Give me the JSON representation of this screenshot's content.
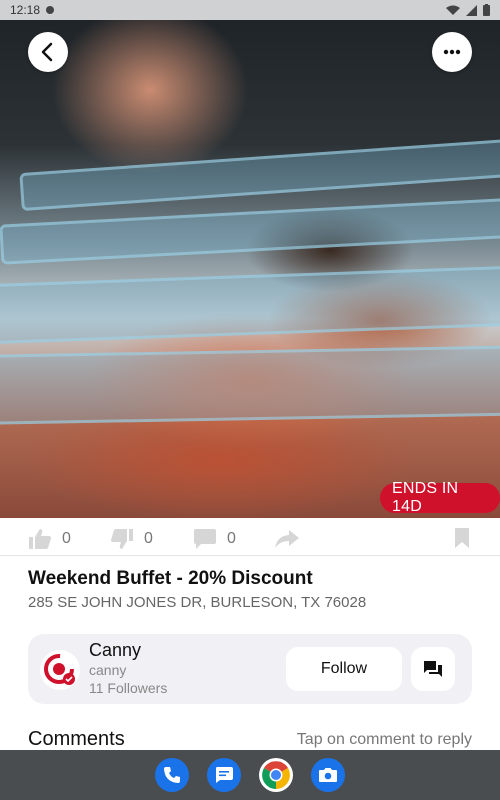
{
  "status_bar": {
    "time": "12:18"
  },
  "header": {
    "back_icon": "chevron-left-icon",
    "more_icon": "more-horizontal-icon"
  },
  "deal": {
    "badge": "ENDS IN 14D",
    "title": "Weekend Buffet - 20% Discount",
    "address": "285 SE JOHN JONES DR, BURLESON, TX 76028"
  },
  "reactions": {
    "likes": "0",
    "dislikes": "0",
    "comments": "0"
  },
  "profile": {
    "name": "Canny",
    "handle": "canny",
    "followers": "11 Followers",
    "follow_label": "Follow"
  },
  "comments": {
    "title": "Comments",
    "hint": "Tap on comment to reply"
  },
  "dock": {
    "apps": [
      "phone-icon",
      "messages-icon",
      "chrome-icon",
      "camera-icon"
    ]
  },
  "colors": {
    "accent": "#d0112b",
    "card": "#f1f1f5",
    "nav": "#4a4d50"
  }
}
